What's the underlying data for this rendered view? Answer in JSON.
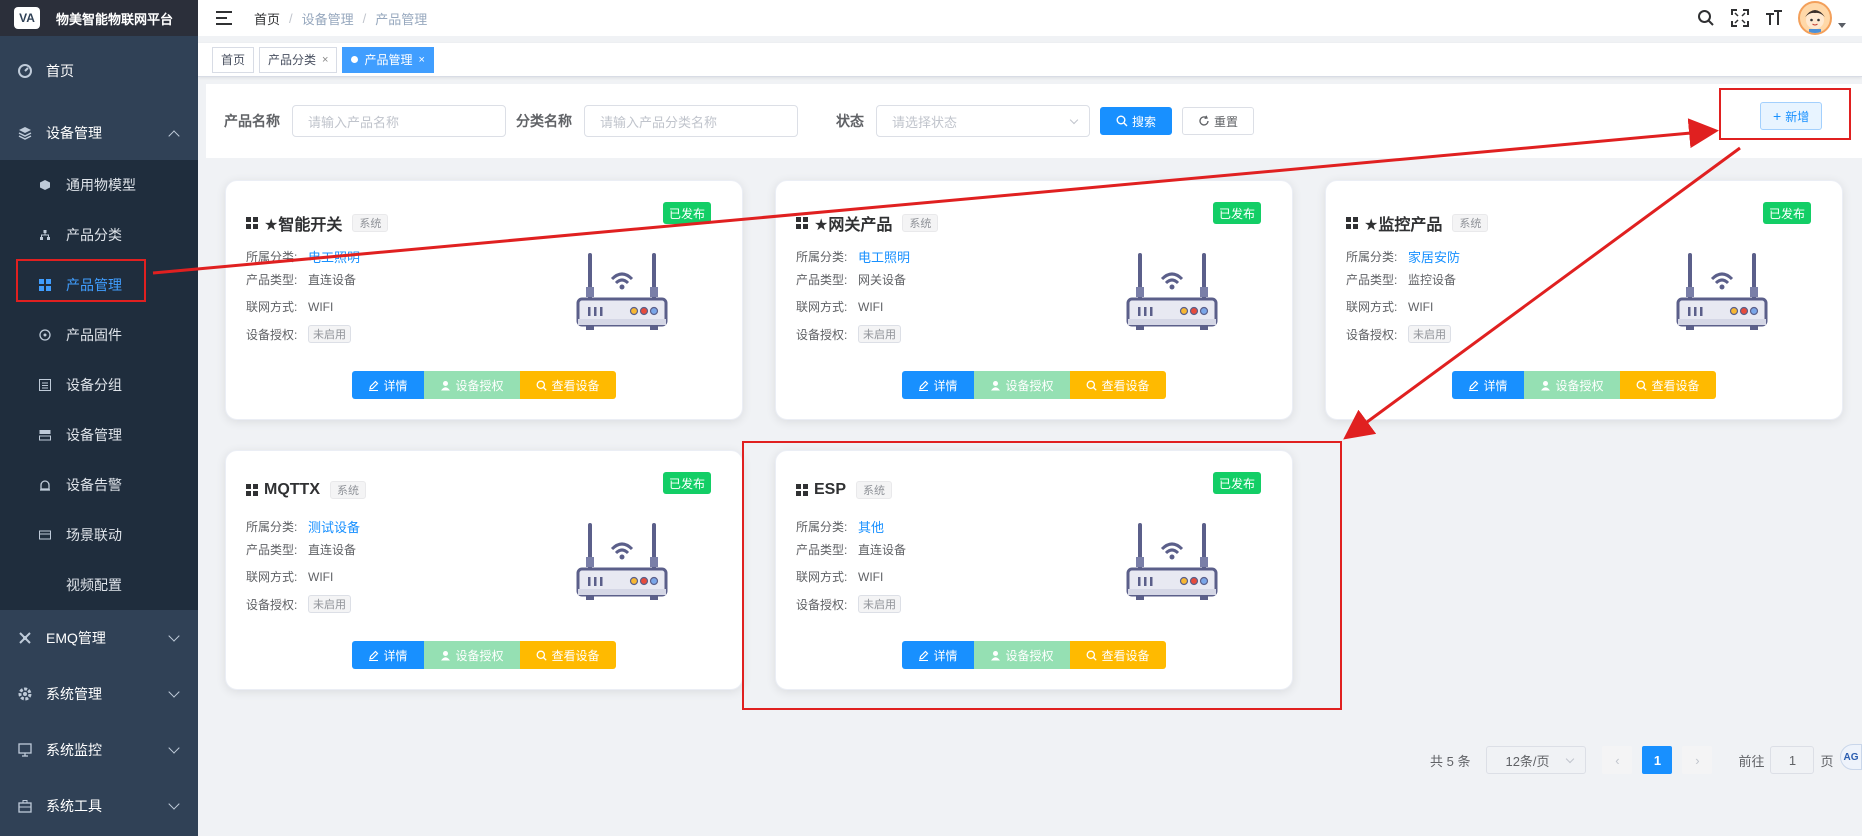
{
  "app": {
    "logo_text": "VA",
    "title": "物美智能物联网平台"
  },
  "sidebar": {
    "home": "首页",
    "device_mgmt": "设备管理",
    "sub_items": [
      "通用物模型",
      "产品分类",
      "产品管理",
      "产品固件",
      "设备分组",
      "设备管理",
      "设备告警",
      "场景联动",
      "视频配置"
    ],
    "active_sub": "产品管理",
    "emq": "EMQ管理",
    "system_mgmt": "系统管理",
    "system_monitor": "系统监控",
    "system_tools": "系统工具"
  },
  "header": {
    "breadcrumb": [
      "首页",
      "设备管理",
      "产品管理"
    ],
    "separator": "/"
  },
  "tags": [
    {
      "label": "首页"
    },
    {
      "label": "产品分类",
      "close": "×"
    },
    {
      "label": "产品管理",
      "close": "×",
      "active": true
    }
  ],
  "filter": {
    "product_name_label": "产品名称",
    "product_name_placeholder": "请输入产品名称",
    "category_label": "分类名称",
    "category_placeholder": "请输入产品分类名称",
    "status_label": "状态",
    "status_placeholder": "请选择状态",
    "search_button": "搜索",
    "reset_button": "重置",
    "add_button": "新增"
  },
  "card_labels": {
    "category": "所属分类:",
    "type": "产品类型:",
    "network": "联网方式:",
    "license": "设备授权:",
    "detail": "详情",
    "auth": "设备授权",
    "view": "查看设备"
  },
  "products": [
    {
      "name": "★智能开关",
      "tag": "系统",
      "status": "已发布",
      "category": "电工照明",
      "type": "直连设备",
      "network": "WIFI",
      "license": "未启用"
    },
    {
      "name": "★网关产品",
      "tag": "系统",
      "status": "已发布",
      "category": "电工照明",
      "type": "网关设备",
      "network": "WIFI",
      "license": "未启用"
    },
    {
      "name": "★监控产品",
      "tag": "系统",
      "status": "已发布",
      "category": "家居安防",
      "type": "监控设备",
      "network": "WIFI",
      "license": "未启用"
    },
    {
      "name": "MQTTX",
      "tag": "系统",
      "status": "已发布",
      "category": "测试设备",
      "type": "直连设备",
      "network": "WIFI",
      "license": "未启用"
    },
    {
      "name": "ESP",
      "tag": "系统",
      "status": "已发布",
      "category": "其他",
      "type": "直连设备",
      "network": "WIFI",
      "license": "未启用"
    }
  ],
  "pagination": {
    "total": "共 5 条",
    "page_size": "12条/页",
    "current_page": "1",
    "goto_label": "前往",
    "goto_value": "1",
    "page_suffix": "页"
  },
  "colors": {
    "sidebar_bg": "#304156",
    "primary": "#1890ff",
    "success": "#13ce66",
    "warning": "#ffba00",
    "annotation": "#e02020"
  }
}
